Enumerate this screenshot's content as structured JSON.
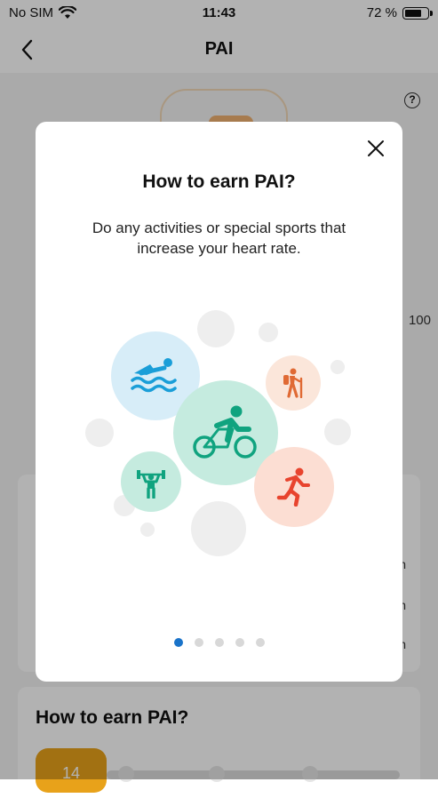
{
  "status_bar": {
    "carrier": "No SIM",
    "time": "11:43",
    "battery": "72 %"
  },
  "nav": {
    "title": "PAI"
  },
  "background": {
    "scale_max": "100",
    "card2_title": "How to earn PAI?",
    "badge_value": "14",
    "row_units": [
      "h",
      "h",
      "h"
    ]
  },
  "modal": {
    "title": "How to earn PAI?",
    "description": "Do any activities or special sports that increase your heart rate.",
    "activities": [
      "swimming-icon",
      "cycling-icon",
      "hiking-icon",
      "strength-training-icon",
      "running-icon"
    ],
    "colors": {
      "swim": "#1a9ed8",
      "cycle": "#10a37f",
      "hike": "#e06a34",
      "strength": "#10a37f",
      "run": "#e8442e"
    },
    "page_count": 5,
    "active_page": 1
  }
}
